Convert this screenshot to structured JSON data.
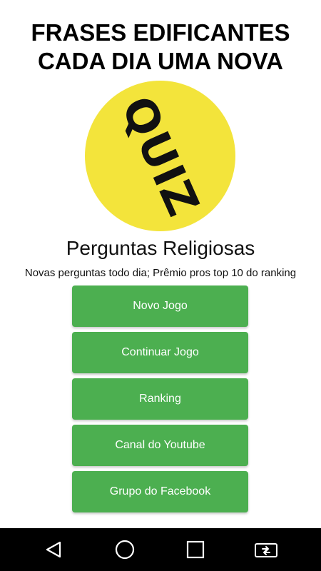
{
  "header": {
    "line1": "FRASES EDIFICANTES",
    "line2": "CADA DIA UMA NOVA"
  },
  "logo": {
    "text": "QUIZ",
    "color": "#f3e43b"
  },
  "main": {
    "subtitle": "Perguntas Religiosas",
    "tagline": "Novas perguntas todo dia; Prêmio pros top 10 do ranking"
  },
  "menu": {
    "color": "#4caf50",
    "items": [
      {
        "label": "Novo Jogo"
      },
      {
        "label": "Continuar Jogo"
      },
      {
        "label": "Ranking"
      },
      {
        "label": "Canal do Youtube"
      },
      {
        "label": "Grupo do Facebook"
      }
    ]
  },
  "navbar": {
    "icons": [
      "back-icon",
      "home-icon",
      "recents-icon",
      "screen-rotate-icon"
    ]
  }
}
